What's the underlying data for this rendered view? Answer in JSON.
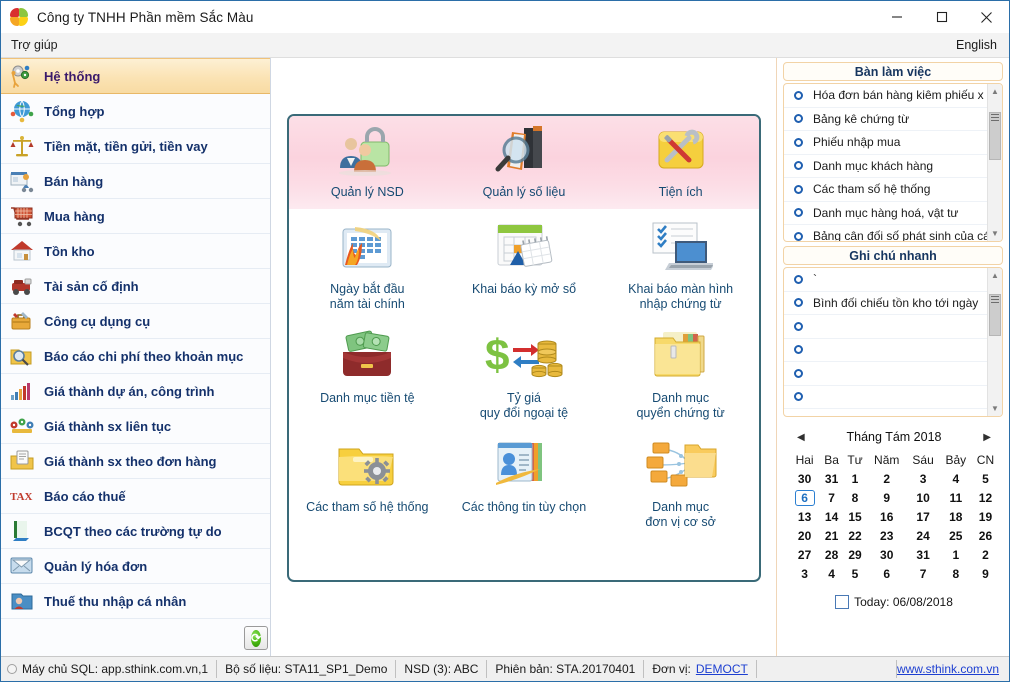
{
  "window": {
    "title": "Công ty TNHH Phần mềm Sắc Màu",
    "logo_icon": "colored-pinwheel-logo",
    "minimize_icon": "minimize-icon",
    "maximize_icon": "maximize-icon",
    "close_icon": "close-icon"
  },
  "menubar": {
    "items": [
      {
        "label": "Trợ giúp"
      }
    ],
    "language": "English"
  },
  "sidebar": {
    "items": [
      {
        "label": "Hệ thống",
        "icon": "gears-worker-icon",
        "active": true
      },
      {
        "label": "Tổng hợp",
        "icon": "globe-people-icon",
        "active": false
      },
      {
        "label": "Tiền mặt, tiền gửi, tiền vay",
        "icon": "balance-scale-icon",
        "active": false
      },
      {
        "label": "Bán hàng",
        "icon": "shop-seller-icon",
        "active": false
      },
      {
        "label": "Mua hàng",
        "icon": "shopping-cart-icon",
        "active": false
      },
      {
        "label": "Tồn kho",
        "icon": "warehouse-house-icon",
        "active": false
      },
      {
        "label": "Tài sản cố định",
        "icon": "machine-icon",
        "active": false
      },
      {
        "label": "Công cụ dụng cụ",
        "icon": "toolbox-icon",
        "active": false
      },
      {
        "label": "Báo cáo chi phí theo khoản mục",
        "icon": "folder-magnifier-icon",
        "active": false
      },
      {
        "label": "Giá thành dự án, công trình",
        "icon": "bar-chart-icon",
        "active": false
      },
      {
        "label": "Giá thành sx liên tục",
        "icon": "gauges-icon",
        "active": false
      },
      {
        "label": "Giá thành sx theo đơn hàng",
        "icon": "folder-document-icon",
        "active": false
      },
      {
        "label": "Báo cáo thuế",
        "icon": "tax-text-icon",
        "active": false
      },
      {
        "label": "BCQT theo các trường tự do",
        "icon": "book-stack-icon",
        "active": false
      },
      {
        "label": "Quản lý hóa đơn",
        "icon": "envelope-screen-icon",
        "active": false
      },
      {
        "label": "Thuế thu nhập cá nhân",
        "icon": "person-folder-icon",
        "active": false
      }
    ]
  },
  "main": {
    "banner_tiles": [
      {
        "label": "Quản lý NSD",
        "icon": "users-lock-icon"
      },
      {
        "label": "Quản lý số liệu",
        "icon": "books-magnifier-icon"
      },
      {
        "label": "Tiện ích",
        "icon": "yellow-folder-tools-icon"
      }
    ],
    "rows": [
      [
        {
          "label": "Ngày bắt đầu\nnăm tài chính",
          "line1": "Ngày bắt đầu",
          "line2": "năm tài chính",
          "icon": "calendar-fire-icon"
        },
        {
          "label": "Khai báo kỳ mở sổ",
          "line1": "Khai báo kỳ mở sổ",
          "line2": "",
          "icon": "calendar-pages-icon"
        },
        {
          "label": "Khai báo màn hình\nnhập chứng từ",
          "line1": "Khai báo màn hình",
          "line2": "nhập chứng từ",
          "icon": "laptop-checklist-icon"
        }
      ],
      [
        {
          "label": "Danh mục tiền tệ",
          "line1": "Danh mục tiền tệ",
          "line2": "",
          "icon": "money-wallet-icon"
        },
        {
          "label": "Tỷ giá\nquy đổi ngoại tệ",
          "line1": "Tỷ giá",
          "line2": "quy đổi ngoại tệ",
          "icon": "dollar-exchange-coins-icon"
        },
        {
          "label": "Danh mục\nquyển chứng từ",
          "line1": "Danh mục",
          "line2": "quyển chứng từ",
          "icon": "folder-files-icon"
        }
      ],
      [
        {
          "label": "Các tham số hệ thống",
          "line1": "Các tham số hệ thống",
          "line2": "",
          "icon": "folder-gear-icon"
        },
        {
          "label": "Các thông tin tùy chọn",
          "line1": "Các thông tin tùy chọn",
          "line2": "",
          "icon": "contact-card-icon"
        },
        {
          "label": "Danh mục\nđơn vị cơ sở",
          "line1": "Danh mục",
          "line2": "đơn vị cơ sở",
          "icon": "folder-network-icon"
        }
      ]
    ],
    "refresh_button_icon": "refresh-green-icon"
  },
  "rightpane": {
    "workdesk": {
      "title": "Bàn làm việc",
      "items": [
        "Hóa đơn bán hàng kiêm phiếu x",
        "Bảng kê chứng từ",
        "Phiếu nhập mua",
        "Danh mục khách hàng",
        "Các tham số hệ thống",
        "Danh mục hàng hoá, vật tư",
        "Bảng cân đối số phát sinh của cá"
      ]
    },
    "notes": {
      "title": "Ghi chú nhanh",
      "items": [
        "`",
        "Bình đối chiếu tồn kho tới ngày",
        "",
        "",
        "",
        ""
      ]
    },
    "calendar": {
      "title": "Tháng Tám 2018",
      "prev_icon": "chevron-left-icon",
      "next_icon": "chevron-right-icon",
      "weekdays": [
        "Hai",
        "Ba",
        "Tư",
        "Năm",
        "Sáu",
        "Bảy",
        "CN"
      ],
      "weeks": [
        [
          {
            "d": "30",
            "t": "dim"
          },
          {
            "d": "31",
            "t": "dim"
          },
          {
            "d": "1",
            "t": "cur"
          },
          {
            "d": "2",
            "t": "cur"
          },
          {
            "d": "3",
            "t": "cur"
          },
          {
            "d": "4",
            "t": "wknd"
          },
          {
            "d": "5",
            "t": "wknd"
          }
        ],
        [
          {
            "d": "6",
            "t": "sel"
          },
          {
            "d": "7",
            "t": "cur"
          },
          {
            "d": "8",
            "t": "cur"
          },
          {
            "d": "9",
            "t": "cur"
          },
          {
            "d": "10",
            "t": "cur"
          },
          {
            "d": "11",
            "t": "wknd"
          },
          {
            "d": "12",
            "t": "wknd"
          }
        ],
        [
          {
            "d": "13",
            "t": "cur"
          },
          {
            "d": "14",
            "t": "cur"
          },
          {
            "d": "15",
            "t": "cur"
          },
          {
            "d": "16",
            "t": "cur"
          },
          {
            "d": "17",
            "t": "cur"
          },
          {
            "d": "18",
            "t": "wknd"
          },
          {
            "d": "19",
            "t": "wknd"
          }
        ],
        [
          {
            "d": "20",
            "t": "cur"
          },
          {
            "d": "21",
            "t": "cur"
          },
          {
            "d": "22",
            "t": "cur"
          },
          {
            "d": "23",
            "t": "cur"
          },
          {
            "d": "24",
            "t": "cur"
          },
          {
            "d": "25",
            "t": "wknd"
          },
          {
            "d": "26",
            "t": "wknd"
          }
        ],
        [
          {
            "d": "27",
            "t": "cur"
          },
          {
            "d": "28",
            "t": "cur"
          },
          {
            "d": "29",
            "t": "cur"
          },
          {
            "d": "30",
            "t": "cur"
          },
          {
            "d": "31",
            "t": "cur"
          },
          {
            "d": "1",
            "t": "dim"
          },
          {
            "d": "2",
            "t": "dim"
          }
        ],
        [
          {
            "d": "3",
            "t": "dim"
          },
          {
            "d": "4",
            "t": "dim"
          },
          {
            "d": "5",
            "t": "dim"
          },
          {
            "d": "6",
            "t": "dim"
          },
          {
            "d": "7",
            "t": "dim"
          },
          {
            "d": "8",
            "t": "dim"
          },
          {
            "d": "9",
            "t": "dim"
          }
        ]
      ],
      "today_label": "Today: 06/08/2018"
    }
  },
  "statusbar": {
    "server": "Máy chủ SQL: app.sthink.com.vn,1",
    "dataset": "Bộ số liệu: STA11_SP1_Demo",
    "user": "NSD (3): ABC",
    "version": "Phiên bản: STA.20170401",
    "unit_label": "Đơn vị:",
    "unit_value": "DEMOCT",
    "website": "www.sthink.com.vn"
  },
  "colors": {
    "accent_orange": "#f2c27a",
    "banner_pink": "#fbd3de",
    "panel_border": "#3a6a78",
    "link_blue": "#1d3fd1",
    "sidebar_text": "#14316b"
  }
}
